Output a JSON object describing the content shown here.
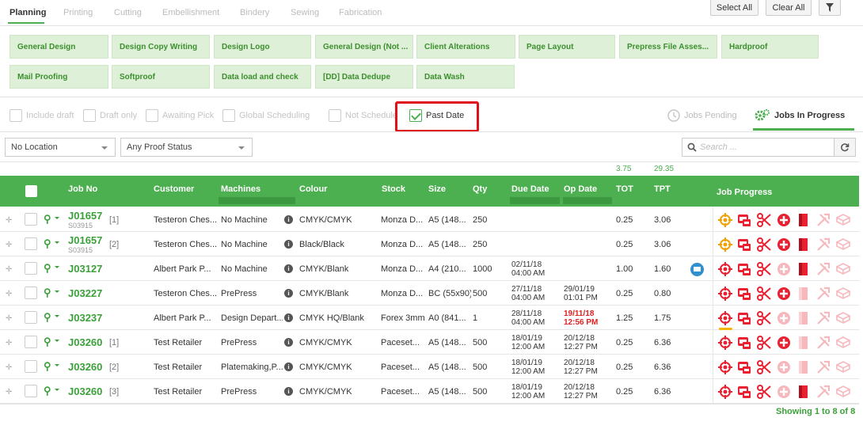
{
  "tabs": [
    "Planning",
    "Printing",
    "Cutting",
    "Embellishment",
    "Bindery",
    "Sewing",
    "Fabrication"
  ],
  "toolbar": {
    "select_all": "Select All",
    "clear_all": "Clear All"
  },
  "processes": [
    "General Design",
    "Design Copy Writing",
    "Design Logo",
    "General Design (Not ...",
    "Client Alterations",
    "Page Layout",
    "Prepress File Asses...",
    "Hardproof",
    "Mail Proofing",
    "Softproof",
    "Data load and check",
    "[DD] Data Dedupe",
    "Data Wash"
  ],
  "filters": [
    {
      "label": "Include draft",
      "checked": false
    },
    {
      "label": "Draft only",
      "checked": false
    },
    {
      "label": "Awaiting Pick",
      "checked": false
    },
    {
      "label": "Global Scheduling",
      "checked": false
    },
    {
      "label": "Not Schedule",
      "checked": false
    },
    {
      "label": "Past Date",
      "checked": true
    }
  ],
  "view_tabs": {
    "pending": "Jobs Pending",
    "in_progress": "Jobs In Progress"
  },
  "location_select": "No Location",
  "proof_select": "Any Proof Status",
  "search_placeholder": "Search ...",
  "totals": {
    "tot": "3.75",
    "tpt": "29.35"
  },
  "columns": [
    "Job No",
    "Customer",
    "Machines",
    "Colour",
    "Stock",
    "Size",
    "Qty",
    "Due Date",
    "Op Date",
    "TOT",
    "TPT",
    "Job Progress"
  ],
  "rows": [
    {
      "job": "J01657",
      "suffix": "[1]",
      "sub": "S03915",
      "customer": "Testeron Ches...",
      "machine": "No Machine",
      "colour": "CMYK/CMYK",
      "stock": "Monza D...",
      "size": "A5 (148...",
      "qty": "250",
      "due1": "",
      "due2": "",
      "op1": "",
      "op2": "",
      "op_red": false,
      "tot": "0.25",
      "tpt": "3.06",
      "mail": false,
      "icons": [
        1,
        1,
        1,
        1,
        1,
        0,
        0
      ],
      "bar": false,
      "first": "gold"
    },
    {
      "job": "J01657",
      "suffix": "[2]",
      "sub": "S03915",
      "customer": "Testeron Ches...",
      "machine": "No Machine",
      "colour": "Black/Black",
      "stock": "Monza D...",
      "size": "A5 (148...",
      "qty": "250",
      "due1": "",
      "due2": "",
      "op1": "",
      "op2": "",
      "op_red": false,
      "tot": "0.25",
      "tpt": "3.06",
      "mail": false,
      "icons": [
        1,
        1,
        1,
        1,
        1,
        0,
        0
      ],
      "bar": false,
      "first": "gold"
    },
    {
      "job": "J03127",
      "suffix": "",
      "sub": "",
      "customer": "Albert Park P...",
      "machine": "No Machine",
      "colour": "CMYK/Blank",
      "stock": "Monza D...",
      "size": "A4 (210...",
      "qty": "1000",
      "due1": "02/11/18",
      "due2": "04:00 AM",
      "op1": "",
      "op2": "",
      "op_red": false,
      "tot": "1.00",
      "tpt": "1.60",
      "mail": true,
      "icons": [
        1,
        1,
        1,
        0,
        1,
        0,
        0
      ],
      "bar": false,
      "first": "red"
    },
    {
      "job": "J03227",
      "suffix": "",
      "sub": "",
      "customer": "Testeron Ches...",
      "machine": "PrePress",
      "colour": "CMYK/Blank",
      "stock": "Monza D...",
      "size": "BC (55x90)",
      "qty": "500",
      "due1": "27/11/18",
      "due2": "04:00 AM",
      "op1": "29/01/19",
      "op2": "01:01 PM",
      "op_red": false,
      "tot": "0.25",
      "tpt": "0.80",
      "mail": false,
      "icons": [
        1,
        1,
        1,
        1,
        0,
        0,
        0
      ],
      "bar": false,
      "first": "red"
    },
    {
      "job": "J03237",
      "suffix": "",
      "sub": "",
      "customer": "Albert Park P...",
      "machine": "Design Depart...",
      "colour": "CMYK HQ/Blank",
      "stock": "Forex 3mm",
      "size": "A0 (841...",
      "qty": "1",
      "due1": "28/11/18",
      "due2": "04:00 AM",
      "op1": "19/11/18",
      "op2": "12:56 PM",
      "op_red": true,
      "tot": "1.25",
      "tpt": "1.75",
      "mail": false,
      "icons": [
        1,
        1,
        1,
        0,
        0,
        0,
        0
      ],
      "bar": true,
      "first": "red"
    },
    {
      "job": "J03260",
      "suffix": "[1]",
      "sub": "",
      "customer": "Test Retailer",
      "machine": "PrePress",
      "colour": "CMYK/CMYK",
      "stock": "Paceset...",
      "size": "A5 (148...",
      "qty": "500",
      "due1": "18/01/19",
      "due2": "12:00 AM",
      "op1": "20/12/18",
      "op2": "12:27 PM",
      "op_red": false,
      "tot": "0.25",
      "tpt": "6.36",
      "mail": false,
      "icons": [
        1,
        1,
        1,
        1,
        0,
        0,
        0
      ],
      "bar": false,
      "first": "red"
    },
    {
      "job": "J03260",
      "suffix": "[2]",
      "sub": "",
      "customer": "Test Retailer",
      "machine": "Platemaking,P...",
      "colour": "CMYK/CMYK",
      "stock": "Paceset...",
      "size": "A5 (148...",
      "qty": "500",
      "due1": "18/01/19",
      "due2": "12:00 AM",
      "op1": "20/12/18",
      "op2": "12:27 PM",
      "op_red": false,
      "tot": "0.25",
      "tpt": "6.36",
      "mail": false,
      "icons": [
        1,
        1,
        1,
        0,
        0,
        0,
        0
      ],
      "bar": false,
      "first": "red"
    },
    {
      "job": "J03260",
      "suffix": "[3]",
      "sub": "",
      "customer": "Test Retailer",
      "machine": "PrePress",
      "colour": "CMYK/CMYK",
      "stock": "Paceset...",
      "size": "A5 (148...",
      "qty": "500",
      "due1": "18/01/19",
      "due2": "12:00 AM",
      "op1": "20/12/18",
      "op2": "12:27 PM",
      "op_red": false,
      "tot": "0.25",
      "tpt": "6.36",
      "mail": false,
      "icons": [
        1,
        1,
        1,
        0,
        1,
        0,
        0
      ],
      "bar": false,
      "first": "red"
    }
  ],
  "footer": "Showing 1 to 8 of 8",
  "colors": {
    "accent": "#4caf50",
    "link": "#3ca03a",
    "status_red": "#e02020"
  }
}
